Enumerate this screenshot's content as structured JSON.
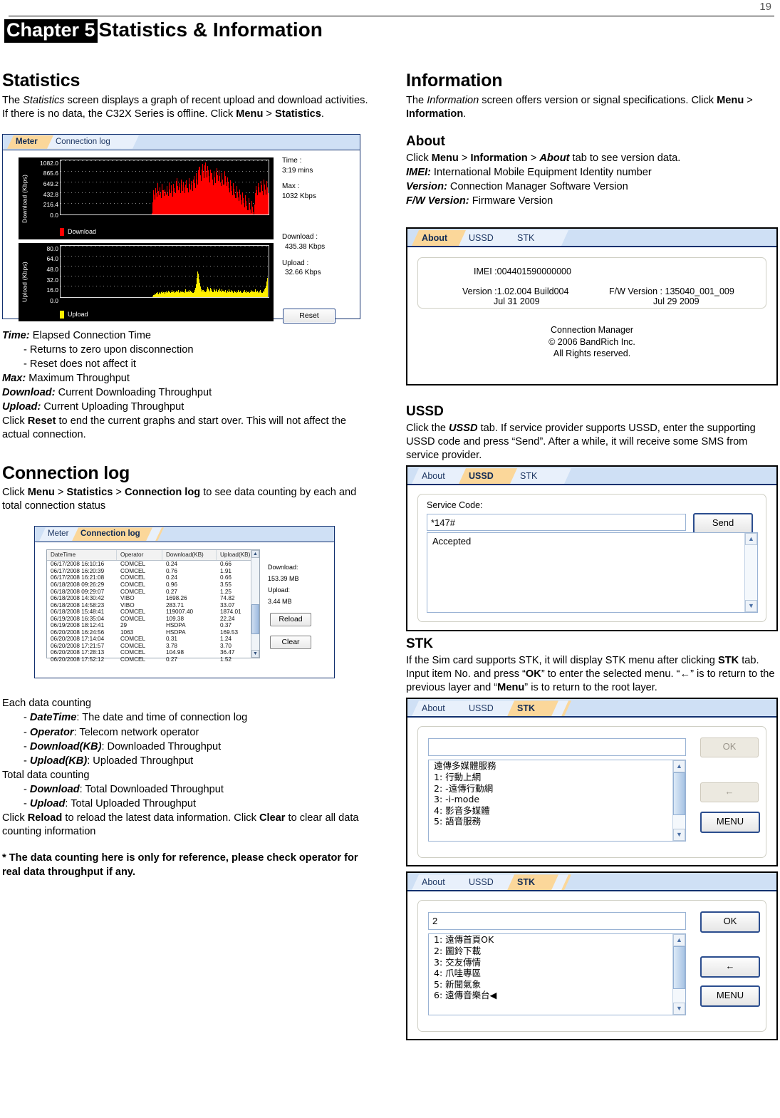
{
  "page": {
    "number": "19"
  },
  "header": {
    "chapter_tag": "Chapter 5",
    "title": "Statistics & Information"
  },
  "left": {
    "statistics": {
      "heading": "Statistics",
      "intro_1": "The ",
      "intro_italic": "Statistics",
      "intro_2": " screen displays a graph of recent upload and download activities. If there is no data, the C32X Series is offline. Click ",
      "intro_bold_1": "Menu",
      "intro_3": " > ",
      "intro_bold_2": "Statistics",
      "intro_4": "."
    },
    "meter_shot": {
      "tabs": [
        {
          "label": "Meter",
          "active": true
        },
        {
          "label": "Connection log",
          "active": false
        }
      ],
      "download_axis_label": "Download (Kbps)",
      "download_ticks": [
        "1082.0",
        "865.6",
        "649.2",
        "432.8",
        "216.4",
        "0.0"
      ],
      "download_legend": "Download",
      "upload_axis_label": "Upload (Kbps)",
      "upload_ticks": [
        "80.0",
        "64.0",
        "48.0",
        "32.0",
        "16.0",
        "0.0"
      ],
      "upload_legend": "Upload",
      "side": {
        "time_label": "Time :",
        "time_value": "3:19 mins",
        "max_label": "Max :",
        "max_value": "1032 Kbps",
        "download_label": "Download :",
        "download_value": "435.38 Kbps",
        "upload_label": "Upload :",
        "upload_value": "32.66 Kbps"
      },
      "reset_button": "Reset",
      "download_color": "#ff0000",
      "upload_color": "#ffef00"
    },
    "legend_defs": [
      {
        "term": "Time:",
        "desc": " Elapsed Connection Time"
      },
      {
        "term": "Max:",
        "desc": " Maximum Throughput"
      },
      {
        "term": "Download:",
        "desc": " Current Downloading Throughput"
      },
      {
        "term": "Upload:",
        "desc": " Current Uploading Throughput"
      }
    ],
    "time_sub_1": "- Returns to zero upon disconnection",
    "time_sub_2": "- Reset does not affect it",
    "reset_note_1": "Click ",
    "reset_note_bold": "Reset",
    "reset_note_2": " to end the current graphs and start over. This will not affect the actual connection.",
    "connection_log": {
      "heading": "Connection log",
      "intro_1": "Click ",
      "intro_b1": "Menu",
      "intro_2": " > ",
      "intro_b2": "Statistics",
      "intro_3": " > ",
      "intro_b3": "Connection log",
      "intro_4": " to see data counting by each and total connection status"
    },
    "log_shot": {
      "tabs": [
        {
          "label": "Meter",
          "active": false
        },
        {
          "label": "Connection log",
          "active": true
        }
      ],
      "columns": [
        "DateTime",
        "Operator",
        "Download(KB)",
        "Upload(KB)"
      ],
      "rows": [
        [
          "06/17/2008 16:10:16",
          "COMCEL",
          "0.24",
          "0.66"
        ],
        [
          "06/17/2008 16:20:39",
          "COMCEL",
          "0.76",
          "1.91"
        ],
        [
          "06/17/2008 16:21:08",
          "COMCEL",
          "0.24",
          "0.66"
        ],
        [
          "06/18/2008 09:26:29",
          "COMCEL",
          "0.96",
          "3.55"
        ],
        [
          "06/18/2008 09:29:07",
          "COMCEL",
          "0.27",
          "1.25"
        ],
        [
          "06/18/2008 14:30:42",
          "VIBO",
          "1698.26",
          "74.82"
        ],
        [
          "06/18/2008 14:58:23",
          "VIBO",
          "283.71",
          "33.07"
        ],
        [
          "06/18/2008 15:48:41",
          "COMCEL",
          "119007.40",
          "1874.01"
        ],
        [
          "06/19/2008 16:35:04",
          "COMCEL",
          "109.38",
          "22.24"
        ],
        [
          "06/19/2008 18:12:41",
          "29",
          "HSDPA",
          "0.37"
        ],
        [
          "06/20/2008 16:24:56",
          "1063",
          "HSDPA",
          "169.53"
        ],
        [
          "06/20/2008 17:14:04",
          "COMCEL",
          "0.31",
          "1.24"
        ],
        [
          "06/20/2008 17:21:57",
          "COMCEL",
          "3.78",
          "3.70"
        ],
        [
          "06/20/2008 17:28:13",
          "COMCEL",
          "104.98",
          "36.47"
        ],
        [
          "06/20/2008 17:52:12",
          "COMCEL",
          "0.27",
          "1.52"
        ]
      ],
      "totals": {
        "download_label": "Download:",
        "download_value": "153.39 MB",
        "upload_label": "Upload:",
        "upload_value": "3.44 MB"
      },
      "reload_button": "Reload",
      "clear_button": "Clear"
    },
    "each_heading": "Each data counting",
    "each_items": [
      {
        "term": "DateTime",
        "desc": ": The date and time of connection log"
      },
      {
        "term": "Operator",
        "desc": ": Telecom network operator"
      },
      {
        "term": "Download(KB)",
        "desc": ": Downloaded Throughput"
      },
      {
        "term": "Upload(KB)",
        "desc": ": Uploaded Throughput"
      }
    ],
    "total_heading": "Total data counting",
    "total_items": [
      {
        "term": "Download",
        "desc": ": Total Downloaded Throughput"
      },
      {
        "term": "Upload",
        "desc": ": Total Uploaded Throughput"
      }
    ],
    "reload_note_1": "Click ",
    "reload_note_b1": "Reload",
    "reload_note_2": " to reload the latest data information.    Click ",
    "reload_note_b2": "Clear",
    "reload_note_3": " to clear all data counting information",
    "footnote": "* The data counting here is only for reference, please check operator for real data throughput if any."
  },
  "right": {
    "information": {
      "heading": "Information",
      "intro_1": "The ",
      "intro_italic": "Information",
      "intro_2": " screen offers version or signal specifications. Click ",
      "intro_b1": "Menu",
      "intro_3": " > ",
      "intro_b2": "Information",
      "intro_4": "."
    },
    "about": {
      "heading": "About",
      "intro_1": "Click ",
      "intro_b1": "Menu",
      "intro_2": " > ",
      "intro_b2": "Information",
      "intro_3": " > ",
      "intro_bi": "About",
      "intro_4": " tab to see version data.",
      "defs": [
        {
          "term": "IMEI:",
          "desc": " International Mobile Equipment Identity number"
        },
        {
          "term": "Version:",
          "desc": " Connection Manager Software Version"
        },
        {
          "term": "F/W Version:",
          "desc": " Firmware Version"
        }
      ]
    },
    "about_shot": {
      "tabs": [
        {
          "label": "About",
          "active": true
        },
        {
          "label": "USSD",
          "active": false
        },
        {
          "label": "STK",
          "active": false
        }
      ],
      "imei_line": "IMEI :004401590000000",
      "version_label": "Version :1.02.004 Build004",
      "version_date": "Jul 31 2009",
      "fw_label": "F/W Version :   135040_001_009",
      "fw_date": "Jul 29 2009",
      "footer_1": "Connection Manager",
      "footer_2": "© 2006 BandRich Inc.",
      "footer_3": "All Rights reserved."
    },
    "ussd": {
      "heading": "USSD",
      "text_1": "Click the ",
      "text_bi": "USSD",
      "text_2": " tab. If service provider supports USSD, enter the supporting USSD code and press “Send”. After a while, it will receive some SMS from service provider."
    },
    "ussd_shot": {
      "tabs": [
        {
          "label": "About",
          "active": false
        },
        {
          "label": "USSD",
          "active": true
        },
        {
          "label": "STK",
          "active": false
        }
      ],
      "service_code_label": "Service Code:",
      "service_code_value": "*147#",
      "send_button": "Send",
      "output_text": "Accepted"
    },
    "stk": {
      "heading": "STK",
      "text_1": "If the Sim card supports STK, it will display STK menu after clicking ",
      "text_b1": "STK",
      "text_2": " tab. Input item No. and press “",
      "text_b2": "OK",
      "text_3": "” to enter the selected menu. “",
      "arrow": "←",
      "text_4": "” is to return to the previous layer and “",
      "text_b3": "Menu",
      "text_5": "” is to return to the root layer."
    },
    "stk_shot_1": {
      "tabs": [
        {
          "label": "About",
          "active": false
        },
        {
          "label": "USSD",
          "active": false
        },
        {
          "label": "STK",
          "active": true
        }
      ],
      "input_value": "",
      "list_items": [
        "遠傳多媒體服務",
        "1: 行動上網",
        "2: -遠傳行動網",
        "3: -i-mode",
        "4: 影音多媒體",
        "5: 語音服務"
      ],
      "ok_button": "OK",
      "back_button": "←",
      "menu_button": "MENU",
      "ok_enabled": false,
      "back_enabled": false,
      "menu_enabled": true
    },
    "stk_shot_2": {
      "tabs": [
        {
          "label": "About",
          "active": false
        },
        {
          "label": "USSD",
          "active": false
        },
        {
          "label": "STK",
          "active": true
        }
      ],
      "input_value": "2",
      "list_items": [
        "1: 遠傳首頁OK",
        "2: 圖鈴下載",
        "3: 交友傳情",
        "4: 爪哇專區",
        "5: 新聞氣象",
        "6: 遠傳音樂台◀"
      ],
      "ok_button": "OK",
      "back_button": "←",
      "menu_button": "MENU",
      "ok_enabled": true,
      "back_enabled": true,
      "menu_enabled": true
    }
  },
  "chart_data": [
    {
      "type": "area",
      "title": "Download",
      "ylabel": "Download (Kbps)",
      "ylim": [
        0,
        1082.0
      ],
      "yticks": [
        0.0,
        216.4,
        432.8,
        649.2,
        865.6,
        1082.0
      ],
      "grid": true,
      "legend": [
        "Download"
      ],
      "color": "#ff0000",
      "background": "#000000",
      "values": [
        0,
        0,
        0,
        0,
        0,
        0,
        0,
        0,
        0,
        0,
        0,
        0,
        0,
        0,
        0,
        0,
        0,
        0,
        0,
        0,
        0,
        0,
        0,
        0,
        0,
        0,
        0,
        0,
        0,
        0,
        0,
        0,
        0,
        0,
        0,
        0,
        0,
        0,
        0,
        0,
        0,
        0,
        0,
        0,
        0,
        0,
        0,
        0,
        0,
        0,
        0,
        0,
        0,
        0,
        0,
        0,
        0,
        0,
        0,
        0,
        0,
        0,
        0,
        0,
        0,
        0,
        0,
        0,
        0,
        0,
        0,
        0,
        0,
        0,
        0,
        0,
        0,
        0,
        0,
        0,
        0,
        0,
        0,
        0,
        0,
        0,
        0,
        0,
        0,
        0,
        0,
        0,
        0,
        0,
        0,
        0,
        0,
        0,
        0,
        0,
        0,
        0,
        0,
        0,
        0,
        0,
        0,
        0,
        0,
        0,
        0,
        0,
        0,
        0,
        0,
        0,
        0,
        0,
        0,
        0,
        30,
        240,
        480,
        390,
        300,
        520,
        430,
        350,
        620,
        470,
        380,
        540,
        420,
        330,
        610,
        480,
        360,
        500,
        450,
        390,
        570,
        430,
        360,
        640,
        500,
        420,
        580,
        470,
        350,
        610,
        530,
        420,
        660,
        720,
        560,
        480,
        620,
        540,
        430,
        700,
        590,
        470,
        650,
        540,
        420,
        600,
        680,
        520,
        440,
        720,
        610,
        500,
        660,
        580,
        470,
        690,
        760,
        620,
        530,
        820,
        700,
        590,
        880,
        950,
        780,
        660,
        900,
        1010,
        850,
        720,
        980,
        1032,
        870,
        740,
        960,
        880,
        760,
        640,
        900,
        820,
        700,
        580,
        860,
        740,
        620,
        840,
        920,
        780,
        660,
        880,
        760,
        640,
        560,
        820,
        700,
        590,
        870,
        760,
        650,
        560,
        740,
        630,
        520,
        440,
        680,
        570,
        460,
        380,
        620,
        510,
        400,
        320,
        560,
        450,
        340,
        260,
        500,
        390,
        280,
        200,
        440,
        330,
        220,
        140,
        380,
        270,
        160,
        80,
        320,
        210,
        100,
        20,
        260,
        150,
        60,
        0,
        200,
        420,
        560,
        480,
        380,
        620,
        540,
        440,
        660,
        580,
        470,
        380,
        700,
        600,
        490,
        400,
        660,
        540,
        430
      ]
    },
    {
      "type": "area",
      "title": "Upload",
      "ylabel": "Upload (Kbps)",
      "ylim": [
        0,
        80.0
      ],
      "yticks": [
        0.0,
        16.0,
        32.0,
        48.0,
        64.0,
        80.0
      ],
      "grid": true,
      "legend": [
        "Upload"
      ],
      "color": "#ffef00",
      "background": "#000000",
      "values": [
        0,
        0,
        0,
        0,
        0,
        0,
        0,
        0,
        0,
        0,
        0,
        0,
        0,
        0,
        0,
        0,
        0,
        0,
        0,
        0,
        0,
        0,
        0,
        0,
        0,
        0,
        0,
        0,
        0,
        0,
        0,
        0,
        0,
        0,
        0,
        0,
        0,
        0,
        0,
        0,
        0,
        0,
        0,
        0,
        0,
        0,
        0,
        0,
        0,
        0,
        0,
        0,
        0,
        0,
        0,
        0,
        0,
        0,
        0,
        0,
        0,
        0,
        0,
        0,
        0,
        0,
        0,
        0,
        0,
        0,
        0,
        0,
        0,
        0,
        0,
        0,
        0,
        0,
        0,
        0,
        0,
        0,
        0,
        0,
        0,
        0,
        0,
        0,
        0,
        0,
        0,
        0,
        0,
        0,
        0,
        0,
        0,
        0,
        0,
        0,
        0,
        0,
        0,
        0,
        0,
        0,
        0,
        0,
        0,
        0,
        0,
        0,
        0,
        0,
        0,
        0,
        0,
        0,
        0,
        0,
        1,
        3,
        5,
        4,
        6,
        5,
        7,
        4,
        6,
        8,
        5,
        7,
        9,
        6,
        8,
        5,
        7,
        9,
        6,
        8,
        10,
        7,
        9,
        6,
        8,
        11,
        7,
        9,
        6,
        8,
        10,
        7,
        9,
        11,
        8,
        6,
        9,
        7,
        10,
        8,
        6,
        9,
        12,
        8,
        10,
        7,
        9,
        11,
        8,
        10,
        7,
        9,
        6,
        8,
        11,
        14,
        20,
        30,
        40,
        36,
        28,
        22,
        16,
        12,
        9,
        11,
        8,
        10,
        7,
        9,
        12,
        15,
        13,
        11,
        9,
        14,
        12,
        10,
        8,
        13,
        11,
        9,
        12,
        10,
        8,
        11,
        9,
        13,
        10,
        8,
        12,
        10,
        7,
        9,
        11,
        8,
        6,
        10,
        8,
        12,
        9,
        7,
        11,
        9,
        6,
        8,
        10,
        7,
        9,
        6,
        8,
        11,
        9,
        7,
        10,
        8,
        6,
        9,
        7,
        11,
        8,
        6,
        10,
        8,
        7,
        9,
        6,
        8,
        11,
        9,
        7,
        10,
        8,
        12,
        9,
        7,
        10,
        8,
        6,
        9,
        11,
        8,
        6,
        10,
        8,
        12,
        14,
        18,
        24,
        30
      ]
    }
  ]
}
